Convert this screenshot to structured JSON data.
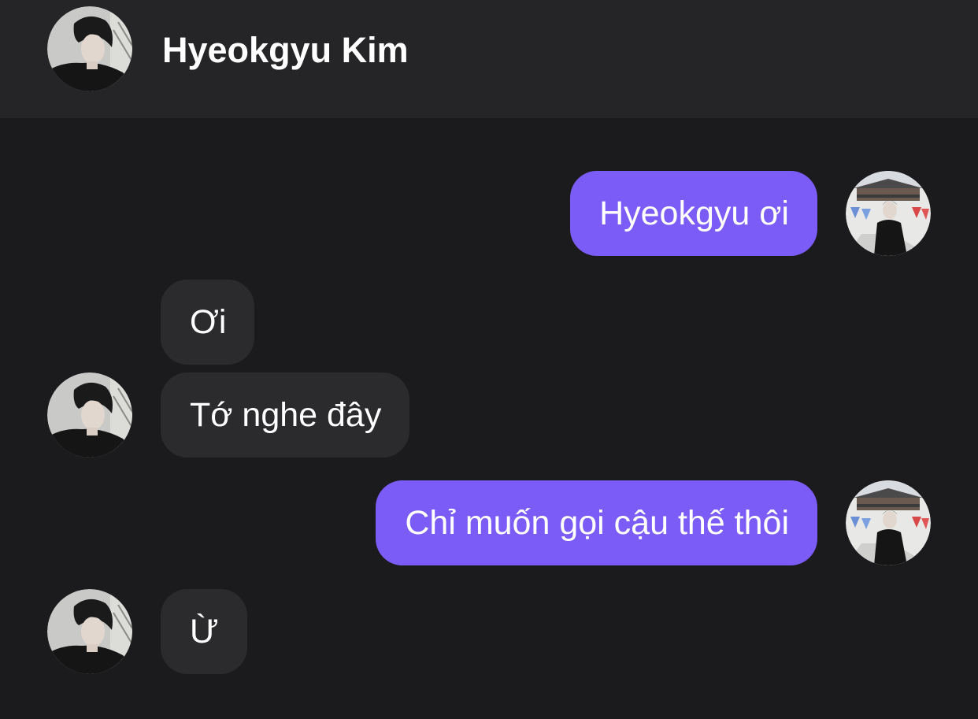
{
  "header": {
    "contact_name": "Hyeokgyu Kim",
    "avatar_icon": "contact-avatar"
  },
  "colors": {
    "background": "#1b1b1d",
    "header_background": "#252527",
    "outgoing_bubble": "#7b5cf6",
    "incoming_bubble": "#2b2b2d",
    "text": "#ffffff"
  },
  "messages": [
    {
      "sender": "me",
      "text": "Hyeokgyu ơi"
    },
    {
      "sender": "them",
      "text": "Ơi"
    },
    {
      "sender": "them",
      "text": "Tớ nghe đây"
    },
    {
      "sender": "me",
      "text": "Chỉ muốn gọi cậu thế thôi"
    },
    {
      "sender": "them",
      "text": "Ừ"
    }
  ]
}
